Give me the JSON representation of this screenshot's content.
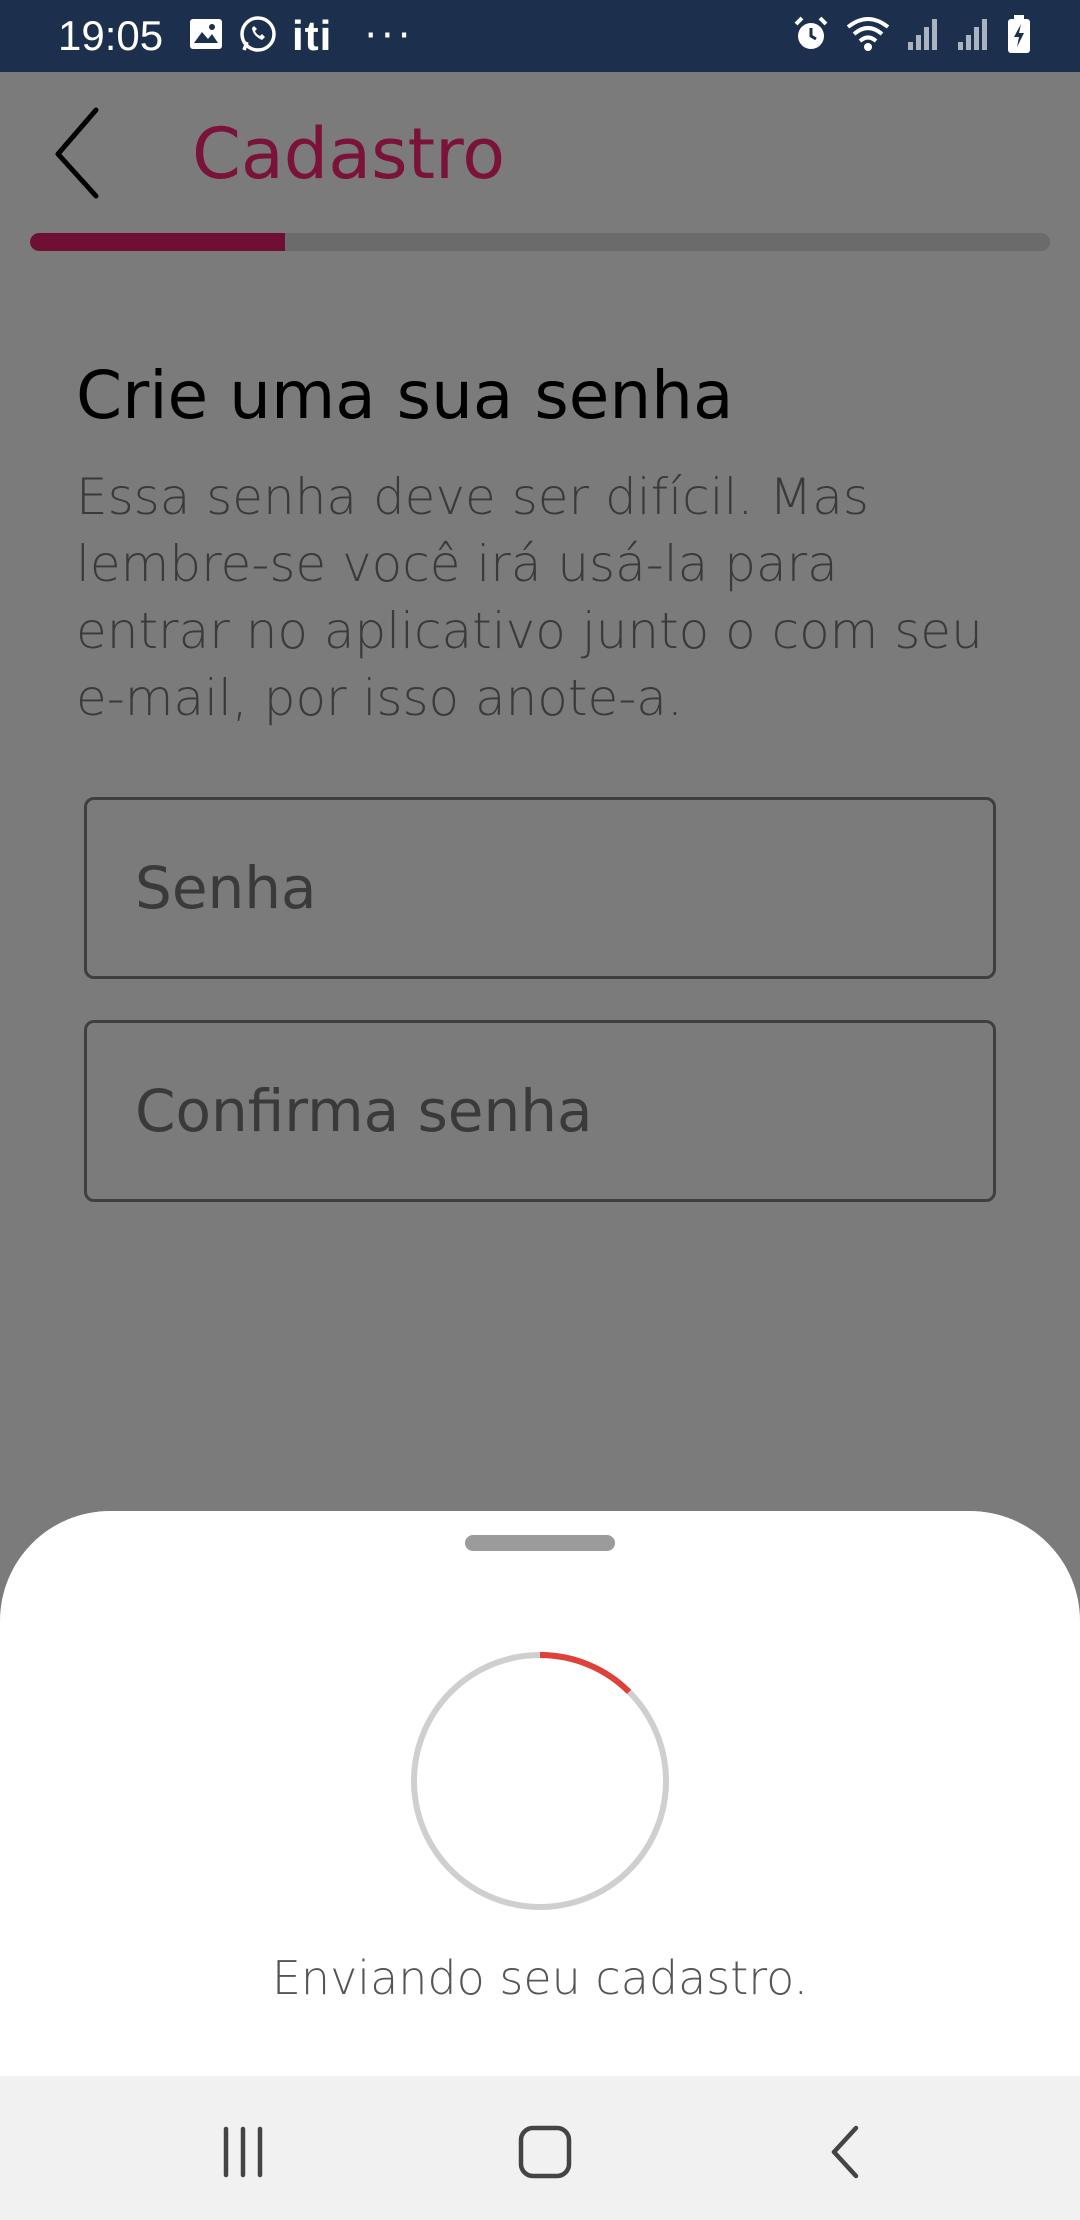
{
  "status_bar": {
    "time": "19:05",
    "app_badge_text": "iti",
    "more_dots": "···",
    "icons": [
      "gallery-icon",
      "whatsapp-icon",
      "iti-icon",
      "alarm-icon",
      "wifi-icon",
      "signal-icon",
      "signal-icon",
      "battery-charging-icon"
    ]
  },
  "header": {
    "title": "Cadastro",
    "back_icon": "chevron-left-icon",
    "progress_fraction": 0.25,
    "accent_color": "#8b1040"
  },
  "form": {
    "heading": "Crie uma sua senha",
    "description": "Essa senha deve ser difícil. Mas lembre-se você irá usá-la para entrar no aplicativo junto o com seu e-mail, por isso anote-a.",
    "password_placeholder": "Senha",
    "confirm_placeholder": "Confirma senha"
  },
  "bottom_sheet": {
    "status_text": "Enviando seu cadastro.",
    "spinner_color": "#e0403a"
  },
  "nav_bar": {
    "icons": [
      "recents-icon",
      "home-icon",
      "back-icon"
    ]
  }
}
